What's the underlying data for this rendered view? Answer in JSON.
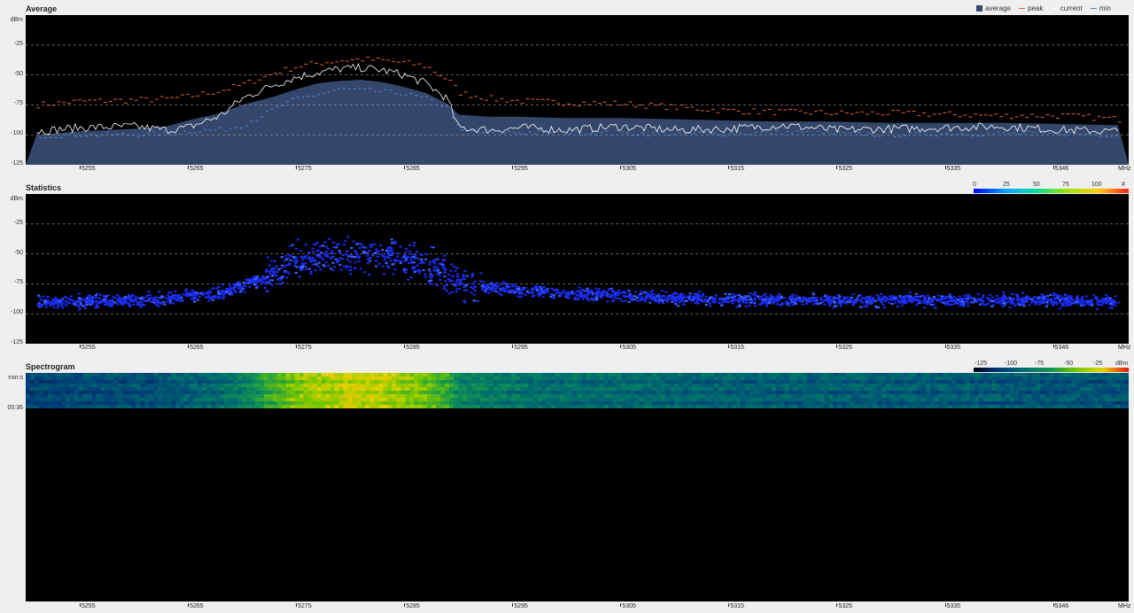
{
  "panels": {
    "average": {
      "title": "Average",
      "unit": "dBm"
    },
    "statistics": {
      "title": "Statistics",
      "unit": "dBm"
    },
    "spectrogram": {
      "title": "Spectrogram",
      "time_labels": [
        "min:s",
        "00:36"
      ]
    }
  },
  "legend": {
    "average": "average",
    "peak": "peak",
    "current": "current",
    "min": "min"
  },
  "colors": {
    "average_fill": "#34476a",
    "peak": "#e0603a",
    "current": "#ffffff",
    "min": "#4a86d4",
    "stats_points": "#1b2cf2",
    "grid": "#9a9a9a"
  },
  "y_ticks": [
    "-25",
    "-50",
    "-75",
    "-100",
    "-125"
  ],
  "x_axis": {
    "ticks": [
      "5255",
      "5265",
      "5275",
      "5285",
      "5295",
      "5305",
      "5315",
      "5325",
      "5335",
      "5346"
    ],
    "unit": "MHz"
  },
  "stats_scale": {
    "labels": [
      "0",
      "25",
      "50",
      "75",
      "100",
      "#"
    ]
  },
  "spec_scale": {
    "labels": [
      "-125",
      "-100",
      "-75",
      "-50",
      "-25",
      "dBm"
    ]
  },
  "chart_data": [
    {
      "type": "area",
      "title": "Average",
      "ylabel": "dBm",
      "xlabel": "MHz",
      "xlim": [
        5250,
        5352
      ],
      "ylim": [
        -125,
        0
      ],
      "grid": true,
      "legend_position": "top-right",
      "x": [
        5251,
        5255,
        5260,
        5263,
        5265,
        5268,
        5270,
        5273,
        5275,
        5277,
        5279,
        5281,
        5283,
        5285,
        5287,
        5289,
        5290,
        5293,
        5296,
        5300,
        5305,
        5310,
        5315,
        5320,
        5325,
        5330,
        5335,
        5340,
        5346,
        5351
      ],
      "series": [
        {
          "name": "average",
          "values": [
            -100,
            -97,
            -95,
            -93,
            -88,
            -82,
            -75,
            -68,
            -62,
            -57,
            -55,
            -54,
            -56,
            -60,
            -65,
            -74,
            -83,
            -85,
            -85,
            -86,
            -86,
            -87,
            -88,
            -89,
            -89,
            -90,
            -90,
            -90,
            -91,
            -92
          ]
        },
        {
          "name": "peak",
          "values": [
            -75,
            -72,
            -71,
            -70,
            -68,
            -63,
            -58,
            -48,
            -43,
            -40,
            -38,
            -37,
            -38,
            -40,
            -43,
            -55,
            -65,
            -70,
            -72,
            -73,
            -74,
            -77,
            -80,
            -81,
            -82,
            -82,
            -83,
            -84,
            -84,
            -87
          ]
        },
        {
          "name": "current",
          "values": [
            -97,
            -94,
            -93,
            -96,
            -94,
            -84,
            -70,
            -58,
            -52,
            -48,
            -45,
            -44,
            -46,
            -50,
            -57,
            -70,
            -94,
            -96,
            -94,
            -96,
            -93,
            -96,
            -95,
            -92,
            -96,
            -95,
            -94,
            -93,
            -96,
            -97
          ]
        },
        {
          "name": "min",
          "values": [
            -101,
            -100,
            -100,
            -99,
            -97,
            -96,
            -92,
            -78,
            -70,
            -66,
            -62,
            -63,
            -64,
            -66,
            -70,
            -78,
            -97,
            -98,
            -98,
            -98,
            -99,
            -99,
            -99,
            -98,
            -99,
            -100,
            -99,
            -99,
            -99,
            -100
          ]
        }
      ]
    },
    {
      "type": "scatter",
      "title": "Statistics",
      "ylabel": "dBm",
      "xlabel": "MHz",
      "xlim": [
        5250,
        5352
      ],
      "ylim": [
        -125,
        0
      ],
      "grid": true,
      "x": [
        5251,
        5255,
        5260,
        5263,
        5265,
        5268,
        5270,
        5273,
        5275,
        5277,
        5279,
        5281,
        5283,
        5285,
        5287,
        5289,
        5290,
        5293,
        5296,
        5300,
        5305,
        5310,
        5315,
        5320,
        5325,
        5330,
        5335,
        5340,
        5346,
        5351
      ],
      "series": [
        {
          "name": "center",
          "values": [
            -90,
            -89,
            -88,
            -87,
            -85,
            -82,
            -76,
            -64,
            -56,
            -53,
            -51,
            -50,
            -51,
            -54,
            -58,
            -66,
            -74,
            -77,
            -80,
            -82,
            -84,
            -86,
            -87,
            -88,
            -88,
            -88,
            -88,
            -88,
            -88,
            -89
          ]
        }
      ]
    },
    {
      "type": "heatmap",
      "title": "Spectrogram",
      "xlabel": "MHz",
      "xlim": [
        5250,
        5352
      ],
      "row_labels": [
        "min:s",
        "00:36"
      ],
      "x": [
        5251,
        5255,
        5260,
        5263,
        5265,
        5268,
        5270,
        5273,
        5275,
        5277,
        5279,
        5281,
        5283,
        5285,
        5287,
        5289,
        5290,
        5293,
        5296,
        5300,
        5305,
        5310,
        5315,
        5320,
        5325,
        5330,
        5335,
        5340,
        5346,
        5351
      ],
      "values_dbm": [
        -97,
        -95,
        -94,
        -93,
        -90,
        -86,
        -82,
        -66,
        -58,
        -55,
        -53,
        -52,
        -53,
        -57,
        -61,
        -68,
        -78,
        -82,
        -84,
        -86,
        -87,
        -88,
        -89,
        -90,
        -90,
        -91,
        -91,
        -91,
        -92,
        -93
      ],
      "color_range": [
        -125,
        -25
      ]
    }
  ]
}
